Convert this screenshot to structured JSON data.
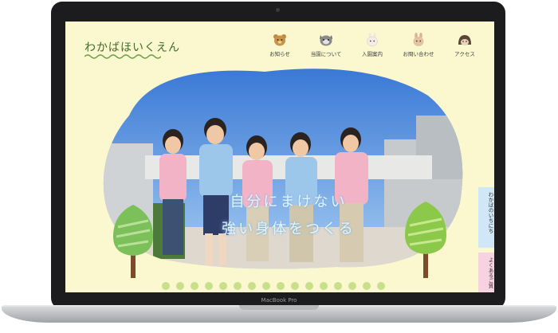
{
  "site": {
    "logo": "わかばほいくえん"
  },
  "nav": {
    "items": [
      {
        "label": "お知らせ",
        "icon": "bear-icon"
      },
      {
        "label": "当園について",
        "icon": "raccoon-icon"
      },
      {
        "label": "入園案内",
        "icon": "rabbit-icon"
      },
      {
        "label": "お問い合わせ",
        "icon": "fox-icon"
      },
      {
        "label": "アクセス",
        "icon": "hedgehog-icon"
      }
    ]
  },
  "hero": {
    "catch_line1": "自分にまけない",
    "catch_line2": "強い身体をつくる"
  },
  "side_tabs": {
    "tab1": "わかばのいちにち",
    "tab2": "よくあるご質"
  },
  "device": {
    "model": "MacBook Pro"
  },
  "colors": {
    "background": "#fbf7cf",
    "logo": "#3e6b2b",
    "tab_blue": "#cfe7f6",
    "tab_pink": "#f7d3e2"
  }
}
